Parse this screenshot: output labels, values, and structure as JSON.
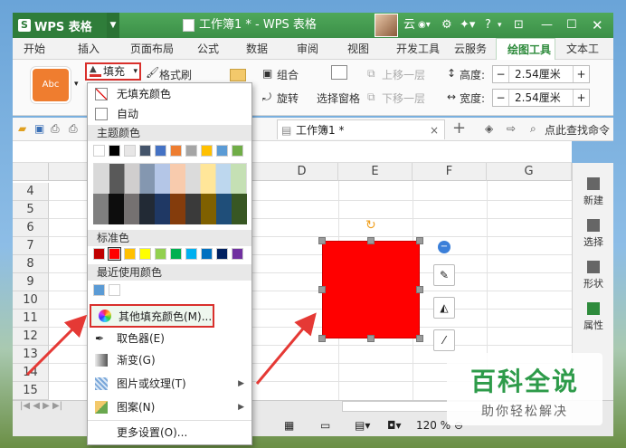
{
  "titlebar": {
    "app_name": "WPS 表格",
    "doc_title": "工作簿1 * - WPS 表格",
    "user_label": "云",
    "help": "?"
  },
  "menu_tabs": [
    "开始",
    "插入",
    "页面布局",
    "公式",
    "数据",
    "审阅",
    "视图",
    "开发工具",
    "云服务",
    "绘图工具",
    "文本工"
  ],
  "ribbon": {
    "style_preview": "Abc",
    "fill_label": "填充",
    "format_painter": "格式刷",
    "group": "组合",
    "rotate": "旋转",
    "selection_pane": "选择窗格",
    "bring_forward": "上移一层",
    "send_backward": "下移一层",
    "height_label": "高度:",
    "height_value": "2.54厘米",
    "width_label": "宽度:",
    "width_value": "2.54厘米",
    "minus": "−",
    "plus": "+"
  },
  "qbar": {
    "workbook_tab": "工作簿1 *",
    "find_command": "点此查找命令",
    "close": "×",
    "new_tab": "+"
  },
  "grid": {
    "columns": [
      "A",
      "D",
      "E",
      "F",
      "G"
    ],
    "rows": [
      "4",
      "5",
      "6",
      "7",
      "8",
      "9",
      "10",
      "11",
      "12",
      "13",
      "14",
      "15"
    ]
  },
  "right_panel": [
    "新建",
    "选择",
    "形状",
    "属性"
  ],
  "status": {
    "zoom": "120 %"
  },
  "dropdown": {
    "no_fill": "无填充颜色",
    "auto": "自动",
    "theme_colors": "主题颜色",
    "standard_colors": "标准色",
    "recent_colors": "最近使用颜色",
    "more_colors": "其他填充颜色(M)...",
    "eyedropper": "取色器(E)",
    "gradient": "渐变(G)",
    "picture_texture": "图片或纹理(T)",
    "pattern": "图案(N)",
    "more_settings": "更多设置(O)...",
    "theme_top": [
      "#ffffff",
      "#000000",
      "#e7e6e6",
      "#44546a",
      "#4472c4",
      "#ed7d31",
      "#a5a5a5",
      "#ffc000",
      "#5b9bd5",
      "#70ad47"
    ],
    "standard": [
      "#c00000",
      "#ff0000",
      "#ffc000",
      "#ffff00",
      "#92d050",
      "#00b050",
      "#00b0f0",
      "#0070c0",
      "#002060",
      "#7030a0"
    ],
    "recent": [
      "#5b9bd5",
      "#ffffff"
    ]
  },
  "shape": {
    "fill_color": "#ff0000"
  },
  "watermark": {
    "main": "百科全说",
    "sub": "助你轻松解决"
  }
}
